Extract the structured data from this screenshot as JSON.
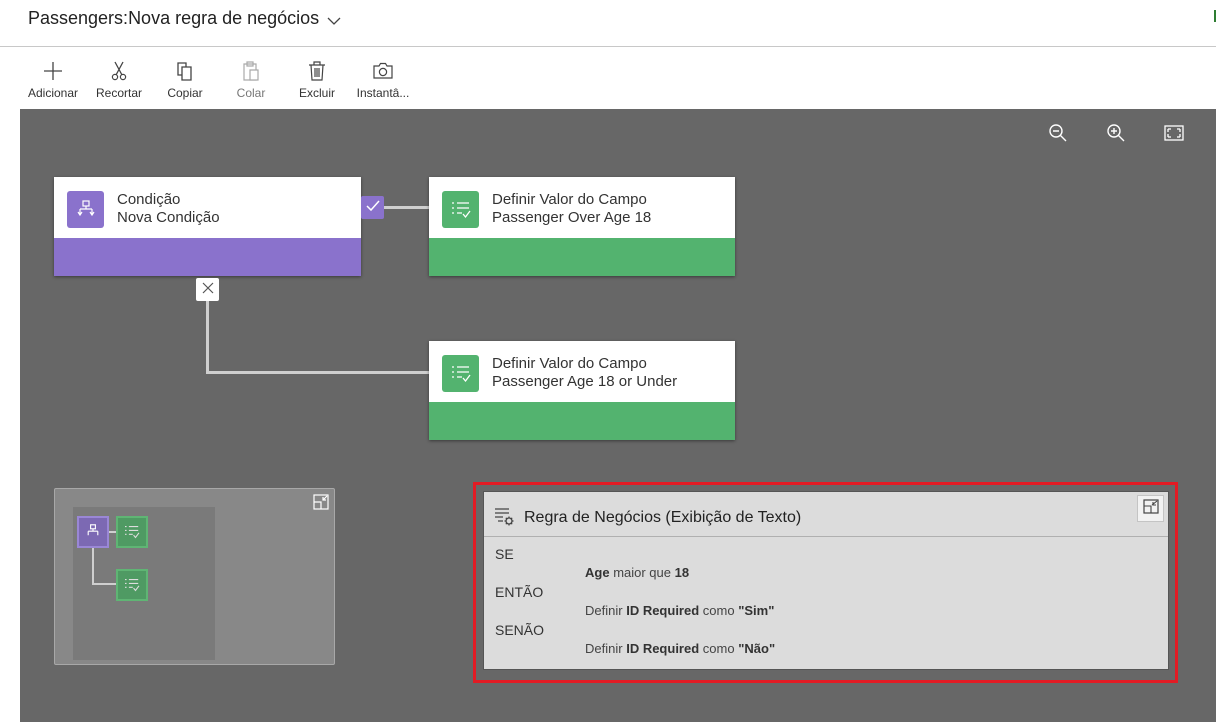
{
  "header": {
    "entity": "Passengers:",
    "rule_name": "Nova regra de negócios",
    "dropdown_icon": "chevron-down-icon"
  },
  "toolbar": {
    "buttons": [
      {
        "label": "Adicionar",
        "icon": "plus-icon",
        "enabled": true
      },
      {
        "label": "Recortar",
        "icon": "scissors-icon",
        "enabled": true
      },
      {
        "label": "Copiar",
        "icon": "copy-icon",
        "enabled": true
      },
      {
        "label": "Colar",
        "icon": "paste-icon",
        "enabled": false
      },
      {
        "label": "Excluir",
        "icon": "trash-icon",
        "enabled": true
      },
      {
        "label": "Instantâ...",
        "icon": "camera-icon",
        "enabled": true
      }
    ]
  },
  "canvas": {
    "controls": [
      "zoom-out-icon",
      "zoom-in-icon",
      "fit-to-screen-icon"
    ],
    "condition_node": {
      "type": "Condição",
      "name": "Nova Condição",
      "color": "#8a72cc"
    },
    "action_true": {
      "type": "Definir Valor do Campo",
      "name": "Passenger Over Age 18",
      "color": "#53b36f"
    },
    "action_false": {
      "type": "Definir Valor do Campo",
      "name": "Passenger Age 18 or Under",
      "color": "#53b36f"
    },
    "true_badge_icon": "checkmark-icon",
    "false_badge_icon": "x-icon"
  },
  "text_view": {
    "title": "Regra de Negócios (Exibição de Texto)",
    "if_label": "SE",
    "if_field": "Age",
    "if_operator": "maior que",
    "if_value": "18",
    "then_label": "ENTÃO",
    "then_verb": "Definir",
    "then_field": "ID Required",
    "then_as": "como",
    "then_value": "\"Sim\"",
    "else_label": "SENÃO",
    "else_verb": "Definir",
    "else_field": "ID Required",
    "else_as": "como",
    "else_value": "\"Não\""
  }
}
